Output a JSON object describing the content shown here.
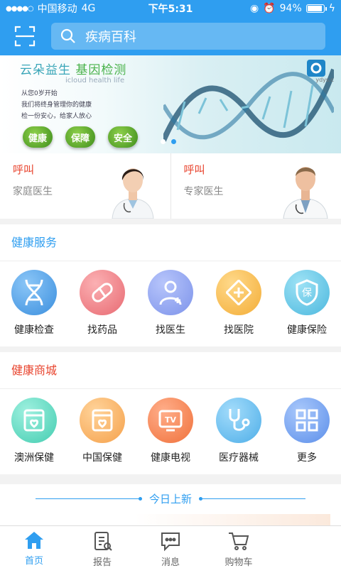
{
  "status_bar": {
    "carrier": "中国移动",
    "network": "4G",
    "time": "下午5:31",
    "battery": "94%",
    "battery_level": 0.94
  },
  "search": {
    "placeholder": "疾病百科"
  },
  "banner": {
    "title_a": "云朵益生",
    "title_b": "基因检测",
    "subtitle": "icloud health life",
    "lines": [
      "从您0岁开始",
      "我们将终身管理你的健康",
      "检一份安心，给家人放心"
    ],
    "pills": [
      "健康",
      "保障",
      "安全"
    ],
    "logo_text": "ydys.c",
    "slide_count": 2,
    "active_slide": 1
  },
  "doctors": [
    {
      "call": "呼叫",
      "role": "家庭医生"
    },
    {
      "call": "呼叫",
      "role": "专家医生"
    }
  ],
  "health_services": {
    "title": "健康服务",
    "title_color": "#2f9ef0",
    "items": [
      {
        "label": "健康检查",
        "icon": "dna-icon"
      },
      {
        "label": "找药品",
        "icon": "pill-icon"
      },
      {
        "label": "找医生",
        "icon": "doctor-icon"
      },
      {
        "label": "找医院",
        "icon": "hospital-icon"
      },
      {
        "label": "健康保险",
        "icon": "insurance-shield-icon"
      }
    ]
  },
  "health_mall": {
    "title": "健康商城",
    "title_color": "#e8432d",
    "items": [
      {
        "label": "澳洲保健",
        "icon": "product-box-icon"
      },
      {
        "label": "中国保健",
        "icon": "product-box-icon"
      },
      {
        "label": "健康电视",
        "icon": "tv-icon"
      },
      {
        "label": "医疗器械",
        "icon": "stethoscope-icon"
      },
      {
        "label": "更多",
        "icon": "grid-icon"
      }
    ]
  },
  "today": {
    "title": "今日上新"
  },
  "tabs": [
    {
      "label": "首页",
      "icon": "home-icon",
      "active": true
    },
    {
      "label": "报告",
      "icon": "report-icon",
      "active": false
    },
    {
      "label": "消息",
      "icon": "message-icon",
      "active": false
    },
    {
      "label": "购物车",
      "icon": "cart-icon",
      "active": false
    }
  ],
  "colors": {
    "primary": "#2f9ef0",
    "accent_red": "#e8432d"
  }
}
